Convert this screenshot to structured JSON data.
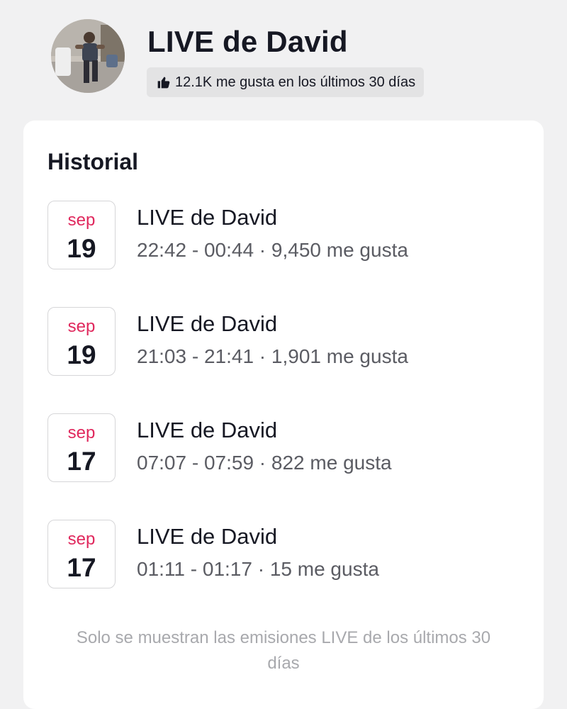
{
  "header": {
    "title": "LIVE de David",
    "likes_summary": "12.1K me gusta en los últimos 30 días"
  },
  "history": {
    "title": "Historial",
    "entries": [
      {
        "month": "sep",
        "day": "19",
        "title": "LIVE de David",
        "meta": "22:42 - 00:44 · 9,450 me gusta"
      },
      {
        "month": "sep",
        "day": "19",
        "title": "LIVE de David",
        "meta": "21:03 - 21:41 · 1,901 me gusta"
      },
      {
        "month": "sep",
        "day": "17",
        "title": "LIVE de David",
        "meta": "07:07 - 07:59 · 822 me gusta"
      },
      {
        "month": "sep",
        "day": "17",
        "title": "LIVE de David",
        "meta": "01:11 - 01:17 · 15 me gusta"
      }
    ],
    "footer_note": "Solo se muestran las emisiones LIVE de los últimos 30 días"
  },
  "colors": {
    "page_background": "#f1f1f2",
    "card_background": "#ffffff",
    "month_accent": "#e0285d",
    "text_primary": "#161823",
    "text_secondary": "#5b5c63",
    "text_muted": "#a8a9ad"
  },
  "icons": {
    "avatar": "profile-photo",
    "likes": "thumbs-up-icon"
  }
}
